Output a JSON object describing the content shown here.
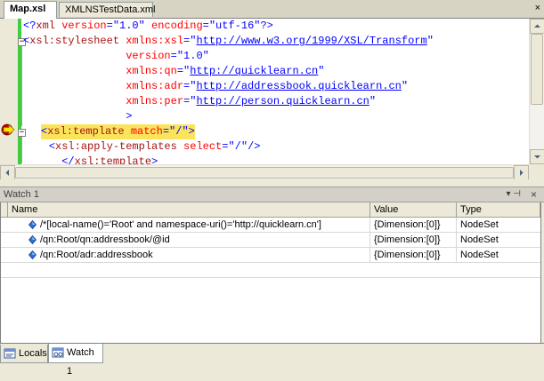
{
  "editor": {
    "tabs": [
      {
        "label": "Map.xsl",
        "active": true
      },
      {
        "label": "XMLNSTestData.xml",
        "active": false
      }
    ],
    "close_glyph": "×",
    "lines": [
      [
        [
          "<?",
          "punct"
        ],
        [
          "xml",
          "elem"
        ],
        [
          " version",
          "attr"
        ],
        [
          "=",
          "punct"
        ],
        [
          "\"1.0\"",
          "val"
        ],
        [
          " encoding",
          "attr"
        ],
        [
          "=",
          "punct"
        ],
        [
          "\"utf-16\"",
          "val"
        ],
        [
          "?>",
          "punct"
        ]
      ],
      [
        [
          "<",
          "punct"
        ],
        [
          "xsl:stylesheet",
          "elem"
        ],
        [
          " xmlns:xsl",
          "attr"
        ],
        [
          "=",
          "punct"
        ],
        [
          "\"",
          "val"
        ],
        [
          "http://www.w3.org/1999/XSL/Transform",
          "url"
        ],
        [
          "\"",
          "val"
        ]
      ],
      [
        [
          "                ",
          "plain"
        ],
        [
          "version",
          "attr"
        ],
        [
          "=",
          "punct"
        ],
        [
          "\"1.0\"",
          "val"
        ]
      ],
      [
        [
          "                ",
          "plain"
        ],
        [
          "xmlns:qn",
          "attr"
        ],
        [
          "=",
          "punct"
        ],
        [
          "\"",
          "val"
        ],
        [
          "http://quicklearn.cn",
          "url"
        ],
        [
          "\"",
          "val"
        ]
      ],
      [
        [
          "                ",
          "plain"
        ],
        [
          "xmlns:adr",
          "attr"
        ],
        [
          "=",
          "punct"
        ],
        [
          "\"",
          "val"
        ],
        [
          "http://addressbook.quicklearn.cn",
          "url"
        ],
        [
          "\"",
          "val"
        ]
      ],
      [
        [
          "                ",
          "plain"
        ],
        [
          "xmlns:per",
          "attr"
        ],
        [
          "=",
          "punct"
        ],
        [
          "\"",
          "val"
        ],
        [
          "http://person.quicklearn.cn",
          "url"
        ],
        [
          "\"",
          "val"
        ]
      ],
      [
        [
          "                ",
          "plain"
        ],
        [
          ">",
          "punct"
        ]
      ],
      [
        [
          "  ",
          "plain"
        ],
        [
          "<",
          "punct"
        ],
        [
          "xsl:template",
          "elem"
        ],
        [
          " match",
          "attr"
        ],
        [
          "=",
          "punct"
        ],
        [
          "\"/\"",
          "val"
        ],
        [
          ">",
          "punct"
        ]
      ],
      [
        [
          "    ",
          "plain"
        ],
        [
          "<",
          "punct"
        ],
        [
          "xsl:apply-templates",
          "elem"
        ],
        [
          " select",
          "attr"
        ],
        [
          "=",
          "punct"
        ],
        [
          "\"/\"",
          "val"
        ],
        [
          "/>",
          "punct"
        ]
      ],
      [
        [
          "      ",
          "plain"
        ],
        [
          "</",
          "punct"
        ],
        [
          "xsl:template",
          "elem"
        ],
        [
          ">",
          "punct"
        ]
      ]
    ],
    "highlighted_line": 7
  },
  "watch": {
    "title": "Watch 1",
    "pin_glyph": "▾ ⊣",
    "close_glyph": "×",
    "columns": {
      "name": "Name",
      "value": "Value",
      "type": "Type"
    },
    "rows": [
      {
        "name": "/*[local-name()='Root' and namespace-uri()='http://quicklearn.cn']",
        "value": "{Dimension:[0]}",
        "type": "NodeSet"
      },
      {
        "name": "/qn:Root/qn:addressbook/@id",
        "value": "{Dimension:[0]}",
        "type": "NodeSet"
      },
      {
        "name": "/qn:Root/adr:addressbook",
        "value": "{Dimension:[0]}",
        "type": "NodeSet"
      }
    ]
  },
  "bottom_tabs": [
    {
      "label": "Locals",
      "icon": "locals-icon",
      "active": false
    },
    {
      "label": "Watch 1",
      "icon": "watch-icon",
      "active": true
    }
  ]
}
